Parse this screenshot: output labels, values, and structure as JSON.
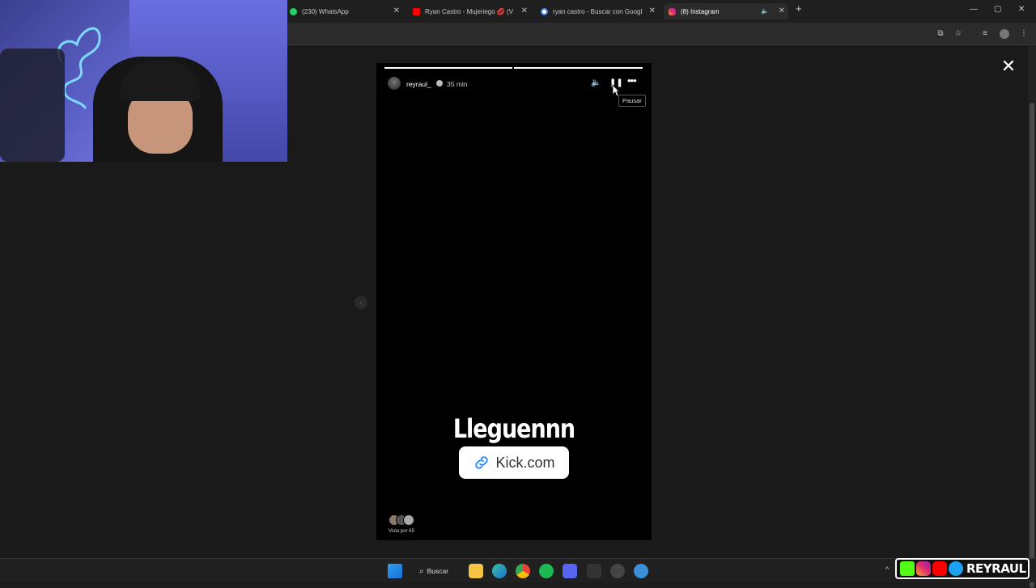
{
  "browser": {
    "tabs": [
      {
        "title": "(230) WhatsApp",
        "favicon_color": "#25d366",
        "active": false
      },
      {
        "title": "Ryan Castro - Mujeriego 💋 (V",
        "favicon_color": "#ff0000",
        "active": false
      },
      {
        "title": "ryan castro - Buscar con Googl",
        "favicon_color": "#4285f4",
        "active": false
      },
      {
        "title": "(8) Instagram",
        "favicon_color": "#e1306c",
        "active": true
      }
    ],
    "new_tab": "+",
    "window_controls": {
      "minimize": "—",
      "maximize": "▢",
      "close": "✕"
    }
  },
  "story": {
    "username": "reyraul_",
    "time_ago": "35 min",
    "tooltip": "Pausar",
    "text": "Lleguennn",
    "link_label": "Kick.com",
    "viewers_label": "Vista por 65",
    "progress_segments": 2,
    "progress_filled": 2
  },
  "taskbar": {
    "search_label": "Buscar"
  },
  "banner": {
    "text": "REYRAUL",
    "colors": {
      "kick": "#53fc18",
      "instagram": "#e1306c",
      "youtube": "#ff0000",
      "twitter": "#1da1f2"
    }
  },
  "colors": {
    "page_bg": "#1a1a1a",
    "story_bg": "#000000",
    "link_icon": "#2d8cff"
  }
}
